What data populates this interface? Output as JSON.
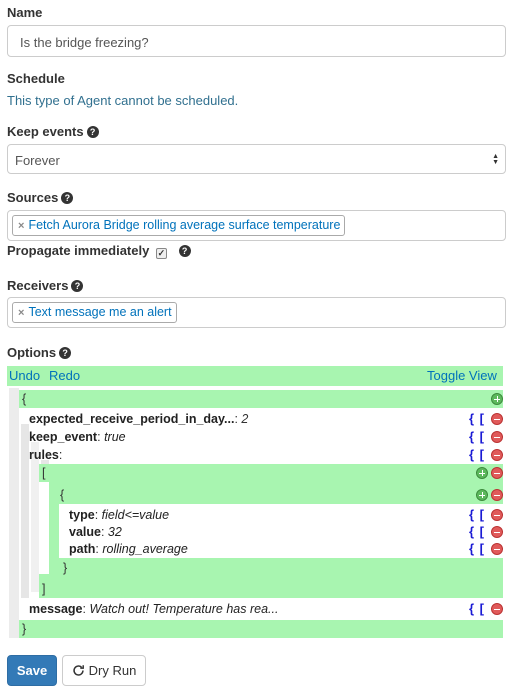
{
  "name": {
    "label": "Name",
    "value": "Is the bridge freezing?"
  },
  "schedule": {
    "label": "Schedule",
    "hint": "This type of Agent cannot be scheduled."
  },
  "keep_events": {
    "label": "Keep events",
    "selected": "Forever"
  },
  "sources": {
    "label": "Sources",
    "token": "Fetch Aurora Bridge rolling average surface temperature"
  },
  "propagate": {
    "label": "Propagate immediately",
    "checked": "✓"
  },
  "receivers": {
    "label": "Receivers",
    "token": "Text message me an alert"
  },
  "options": {
    "label": "Options",
    "menu": {
      "undo": "Undo",
      "redo": "Redo",
      "toggle": "Toggle View"
    },
    "open_brace": "{",
    "close_brace": "}",
    "open_bracket": "[",
    "close_bracket": "]",
    "brace_icon": "{ [",
    "entries": {
      "expected_key": "expected_receive_period_in_day...",
      "expected_value": "2",
      "keep_key": "keep_event",
      "keep_value": "true",
      "rules_key": "rules",
      "type_key": "type",
      "type_value": "field<=value",
      "value_key": "value",
      "value_value": "32",
      "path_key": "path",
      "path_value": "rolling_average",
      "message_key": "message",
      "message_value": "Watch out! Temperature has rea..."
    }
  },
  "buttons": {
    "save": "Save",
    "dry_run": "Dry Run"
  },
  "colors": {
    "primary": "#337ab7",
    "link": "#0072bb",
    "editor_green": "#a8f5b0",
    "delete_red": "#e05a5a",
    "add_green": "#5cb85c"
  }
}
